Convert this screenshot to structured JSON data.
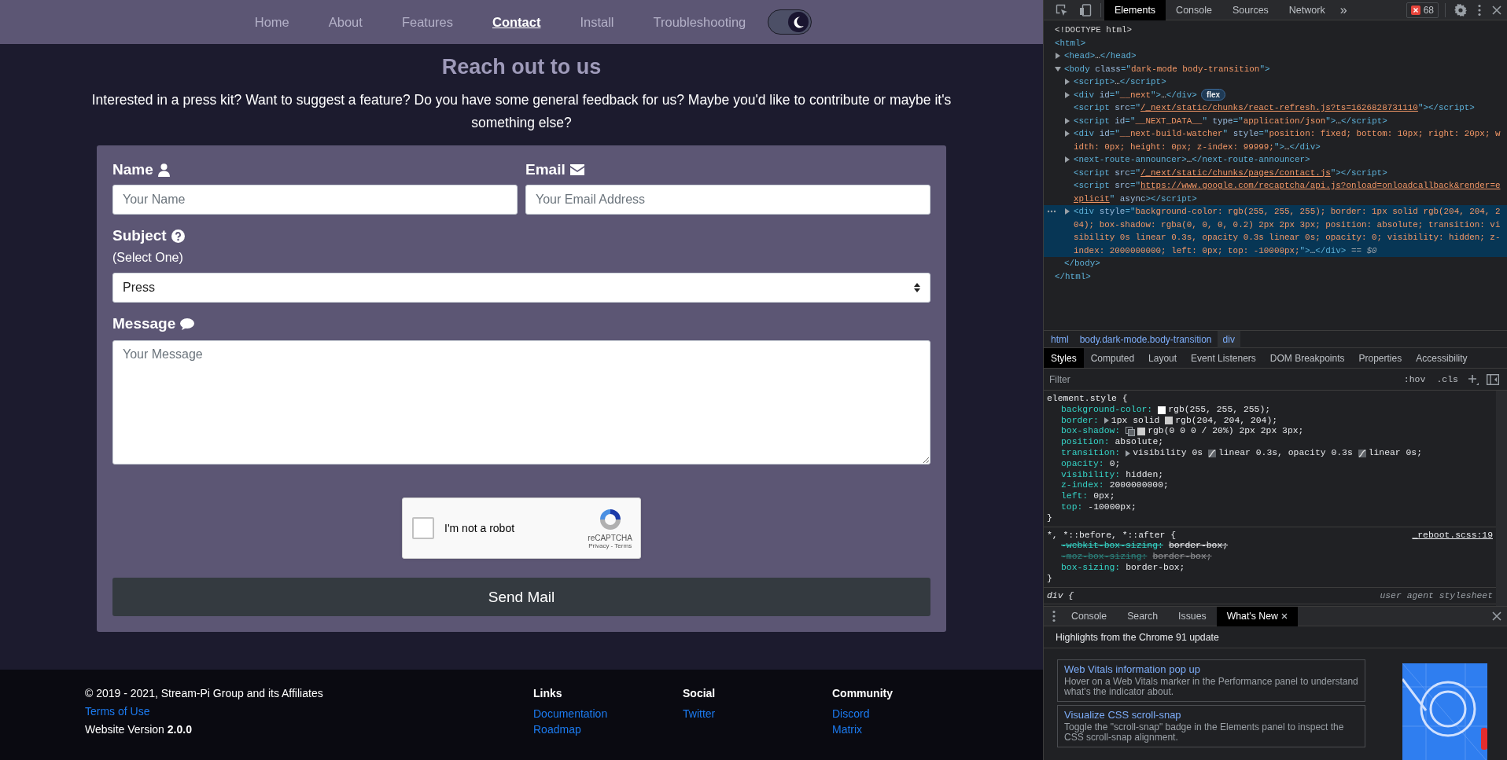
{
  "site_nav": {
    "items": [
      {
        "label": "Home",
        "selected": false
      },
      {
        "label": "About",
        "selected": false
      },
      {
        "label": "Features",
        "selected": false
      },
      {
        "label": "Contact",
        "selected": true
      },
      {
        "label": "Install",
        "selected": false
      },
      {
        "label": "Troubleshooting",
        "selected": false
      }
    ],
    "theme_toggle": {
      "on": true
    }
  },
  "contact": {
    "title": "Reach out to us",
    "intro": "Interested in a press kit? Want to suggest a feature? Do you have some general feedback for us? Maybe you'd like to contribute or maybe it's something else?",
    "fields": [
      {
        "kind": "text",
        "label": "Name",
        "placeholder": "Your Name"
      },
      {
        "kind": "text",
        "label": "Email",
        "placeholder": "Your Email Address"
      },
      {
        "kind": "select",
        "label": "Subject",
        "hint": "(Select One)",
        "value": "Press"
      },
      {
        "kind": "textarea",
        "label": "Message",
        "placeholder": "Your Message"
      }
    ],
    "captcha": {
      "label": "I'm not a robot",
      "checked": false,
      "brand": "reCAPTCHA",
      "links": "Privacy - Terms"
    },
    "submit": "Send Mail"
  },
  "footer": {
    "copyright": "© 2019 - 2021, Stream-Pi Group and its Affiliates",
    "terms": "Terms of Use",
    "version": "Website Version **2.0.0**",
    "columns": [
      {
        "heading": "Links",
        "links": [
          "Documentation",
          "Roadmap"
        ]
      },
      {
        "heading": "Social",
        "links": [
          "Twitter"
        ]
      },
      {
        "heading": "Community",
        "links": [
          "Discord",
          "Matrix"
        ]
      }
    ]
  },
  "devtools": {
    "tabs": [
      {
        "label": "Elements",
        "selected": true
      },
      {
        "label": "Console",
        "selected": false
      },
      {
        "label": "Sources",
        "selected": false
      },
      {
        "label": "Network",
        "selected": false
      }
    ],
    "more": "»",
    "errors": "68",
    "dom": [
      {
        "selected": false,
        "segs": [
          {
            "kind": "doctype",
            "text": "<!DOCTYPE html>"
          }
        ]
      },
      {
        "selected": false,
        "segs": [
          {
            "kind": "tag",
            "text": "<html>"
          }
        ],
        "close": [
          {
            "kind": "tag",
            "text": "</html>"
          }
        ],
        "children": [
          {
            "selected": false,
            "expanded": false,
            "segs": [
              {
                "kind": "tag",
                "text": "<head>"
              },
              {
                "kind": "text",
                "text": "…"
              },
              {
                "kind": "tag",
                "text": "</head>"
              }
            ]
          },
          {
            "selected": false,
            "expanded": true,
            "segs": [
              {
                "kind": "tag",
                "text": "<body"
              },
              {
                "kind": "attr",
                "text": " class"
              },
              {
                "kind": "tag",
                "text": "=\""
              },
              {
                "kind": "val",
                "text": "dark-mode body-transition"
              },
              {
                "kind": "tag",
                "text": "\">"
              }
            ],
            "close": [
              {
                "kind": "tag",
                "text": "</body>"
              }
            ],
            "children": [
              {
                "selected": false,
                "expanded": false,
                "segs": [
                  {
                    "kind": "tag",
                    "text": "<script>"
                  },
                  {
                    "kind": "text",
                    "text": "…"
                  },
                  {
                    "kind": "tag",
                    "text": "</script>"
                  }
                ]
              },
              {
                "selected": false,
                "expanded": false,
                "badge": "flex",
                "segs": [
                  {
                    "kind": "tag",
                    "text": "<div"
                  },
                  {
                    "kind": "attr",
                    "text": " id"
                  },
                  {
                    "kind": "tag",
                    "text": "=\""
                  },
                  {
                    "kind": "val",
                    "text": "__next"
                  },
                  {
                    "kind": "tag",
                    "text": "\">"
                  },
                  {
                    "kind": "text",
                    "text": "…"
                  },
                  {
                    "kind": "tag",
                    "text": "</div>"
                  }
                ]
              },
              {
                "selected": false,
                "segs": [
                  {
                    "kind": "tag",
                    "text": "<script"
                  },
                  {
                    "kind": "attr",
                    "text": " src"
                  },
                  {
                    "kind": "tag",
                    "text": "=\""
                  },
                  {
                    "kind": "link",
                    "text": "/_next/static/chunks/react-refresh.js?ts=1626828731110"
                  },
                  {
                    "kind": "tag",
                    "text": "\"></script>"
                  }
                ]
              },
              {
                "selected": false,
                "expanded": false,
                "segs": [
                  {
                    "kind": "tag",
                    "text": "<script"
                  },
                  {
                    "kind": "attr",
                    "text": " id"
                  },
                  {
                    "kind": "tag",
                    "text": "=\""
                  },
                  {
                    "kind": "val",
                    "text": "__NEXT_DATA__"
                  },
                  {
                    "kind": "tag",
                    "text": "\""
                  },
                  {
                    "kind": "attr",
                    "text": " type"
                  },
                  {
                    "kind": "tag",
                    "text": "=\""
                  },
                  {
                    "kind": "val",
                    "text": "application/json"
                  },
                  {
                    "kind": "tag",
                    "text": "\">"
                  },
                  {
                    "kind": "text",
                    "text": "…"
                  },
                  {
                    "kind": "tag",
                    "text": "</script>"
                  }
                ]
              },
              {
                "selected": false,
                "expanded": false,
                "segs": [
                  {
                    "kind": "tag",
                    "text": "<div"
                  },
                  {
                    "kind": "attr",
                    "text": " id"
                  },
                  {
                    "kind": "tag",
                    "text": "=\""
                  },
                  {
                    "kind": "val",
                    "text": "__next-build-watcher"
                  },
                  {
                    "kind": "tag",
                    "text": "\""
                  },
                  {
                    "kind": "attr",
                    "text": " style"
                  },
                  {
                    "kind": "tag",
                    "text": "=\""
                  },
                  {
                    "kind": "val",
                    "text": "position: fixed; bottom: 10px; right: 20px; width: 0px; height: 0px; z-index: 99999;"
                  },
                  {
                    "kind": "tag",
                    "text": "\">"
                  },
                  {
                    "kind": "text",
                    "text": "…"
                  },
                  {
                    "kind": "tag",
                    "text": "</div>"
                  }
                ]
              },
              {
                "selected": false,
                "expanded": false,
                "segs": [
                  {
                    "kind": "tag",
                    "text": "<next-route-announcer>"
                  },
                  {
                    "kind": "text",
                    "text": "…"
                  },
                  {
                    "kind": "tag",
                    "text": "</next-route-announcer>"
                  }
                ]
              },
              {
                "selected": false,
                "segs": [
                  {
                    "kind": "tag",
                    "text": "<script"
                  },
                  {
                    "kind": "attr",
                    "text": " src"
                  },
                  {
                    "kind": "tag",
                    "text": "=\""
                  },
                  {
                    "kind": "link",
                    "text": "/_next/static/chunks/pages/contact.js"
                  },
                  {
                    "kind": "tag",
                    "text": "\"></script>"
                  }
                ]
              },
              {
                "selected": false,
                "segs": [
                  {
                    "kind": "tag",
                    "text": "<script"
                  },
                  {
                    "kind": "attr",
                    "text": " src"
                  },
                  {
                    "kind": "tag",
                    "text": "=\""
                  },
                  {
                    "kind": "link",
                    "text": "https://www.google.com/recaptcha/api.js?onload=onloadcallback&render=explicit"
                  },
                  {
                    "kind": "tag",
                    "text": "\""
                  },
                  {
                    "kind": "attr",
                    "text": " async"
                  },
                  {
                    "kind": "tag",
                    "text": "></script>"
                  }
                ]
              },
              {
                "selected": true,
                "expanded": false,
                "segs": [
                  {
                    "kind": "tag",
                    "text": "<div"
                  },
                  {
                    "kind": "attr",
                    "text": " style"
                  },
                  {
                    "kind": "tag",
                    "text": "=\""
                  },
                  {
                    "kind": "val",
                    "text": "background-color: rgb(255, 255, 255); border: 1px solid rgb(204, 204, 204); box-shadow: rgba(0, 0, 0, 0.2) 2px 2px 3px; position: absolute; transition: visibility 0s linear 0.3s, opacity 0.3s linear 0s; opacity: 0; visibility: hidden; z-index: 2000000000; left: 0px; top: -10000px;"
                  },
                  {
                    "kind": "tag",
                    "text": "\">"
                  },
                  {
                    "kind": "text",
                    "text": "…"
                  },
                  {
                    "kind": "tag",
                    "text": "</div>"
                  },
                  {
                    "kind": "ref",
                    "text": " == $0"
                  }
                ]
              }
            ]
          }
        ]
      }
    ],
    "breadcrumbs": [
      {
        "label": "html",
        "selected": false
      },
      {
        "label": "body.dark-mode.body-transition",
        "selected": false
      },
      {
        "label": "div",
        "selected": true
      }
    ],
    "sidebar_tabs": [
      {
        "label": "Styles",
        "selected": true
      },
      {
        "label": "Computed",
        "selected": false
      },
      {
        "label": "Layout",
        "selected": false
      },
      {
        "label": "Event Listeners",
        "selected": false
      },
      {
        "label": "DOM Breakpoints",
        "selected": false
      },
      {
        "label": "Properties",
        "selected": false
      },
      {
        "label": "Accessibility",
        "selected": false
      }
    ],
    "filter": {
      "placeholder": "Filter"
    },
    "hov": ":hov",
    "cls": ".cls",
    "rules": [
      {
        "kind": "inline",
        "selector": "element.style {",
        "close": "}",
        "props": [
          {
            "kind": "color",
            "name": "background-color:",
            "value": "rgb(255, 255, 255);",
            "color": "#ffffff",
            "overridden": false,
            "unsupported": false
          },
          {
            "kind": "shorthand-color",
            "name": "border:",
            "pre": "1px solid ",
            "value": "rgb(204, 204, 204);",
            "color": "#cccccc",
            "overridden": false,
            "unsupported": false
          },
          {
            "kind": "shadow",
            "name": "box-shadow:",
            "value": "rgb(0 0 0 / 20%) 2px 2px 3px;",
            "color": "#cccccc",
            "overridden": false,
            "unsupported": false
          },
          {
            "kind": "plain",
            "name": "position:",
            "value": "absolute;",
            "overridden": false,
            "unsupported": false
          },
          {
            "kind": "timing",
            "name": "transition:",
            "parts": [
              "visibility 0s ",
              "linear 0.3s, opacity 0.3s ",
              "linear 0s;"
            ],
            "overridden": false,
            "unsupported": false
          },
          {
            "kind": "plain",
            "name": "opacity:",
            "value": "0;",
            "overridden": false,
            "unsupported": false
          },
          {
            "kind": "plain",
            "name": "visibility:",
            "value": "hidden;",
            "overridden": false,
            "unsupported": false
          },
          {
            "kind": "plain",
            "name": "z-index:",
            "value": "2000000000;",
            "overridden": false,
            "unsupported": false
          },
          {
            "kind": "plain",
            "name": "left:",
            "value": "0px;",
            "overridden": false,
            "unsupported": false
          },
          {
            "kind": "plain",
            "name": "top:",
            "value": "-10000px;",
            "overridden": false,
            "unsupported": false
          }
        ]
      },
      {
        "kind": "author",
        "selector": "*, *::before, *::after {",
        "source": "_reboot.scss:19",
        "close": "}",
        "props": [
          {
            "kind": "plain",
            "name": "-webkit-box-sizing:",
            "value": "border-box;",
            "overridden": true,
            "unsupported": false
          },
          {
            "kind": "plain",
            "name": "-moz-box-sizing:",
            "value": "border-box;",
            "overridden": true,
            "unsupported": true
          },
          {
            "kind": "plain",
            "name": "box-sizing:",
            "value": "border-box;",
            "overridden": false,
            "unsupported": false
          }
        ]
      },
      {
        "kind": "ua",
        "selector": "div {",
        "source": "user agent stylesheet"
      }
    ],
    "drawer": {
      "tabs": [
        {
          "label": "Console",
          "selected": false
        },
        {
          "label": "Search",
          "selected": false
        },
        {
          "label": "Issues",
          "selected": false
        },
        {
          "label": "What's New",
          "selected": true
        }
      ],
      "header": "Highlights from the Chrome 91 update",
      "cards": [
        {
          "title": "Web Vitals information pop up",
          "text": "Hover on a Web Vitals marker in the Performance panel to understand what's the indicator about."
        },
        {
          "title": "Visualize CSS scroll-snap",
          "text": "Toggle the \"scroll-snap\" badge in the Elements panel to inspect the CSS scroll-snap alignment."
        }
      ]
    }
  }
}
